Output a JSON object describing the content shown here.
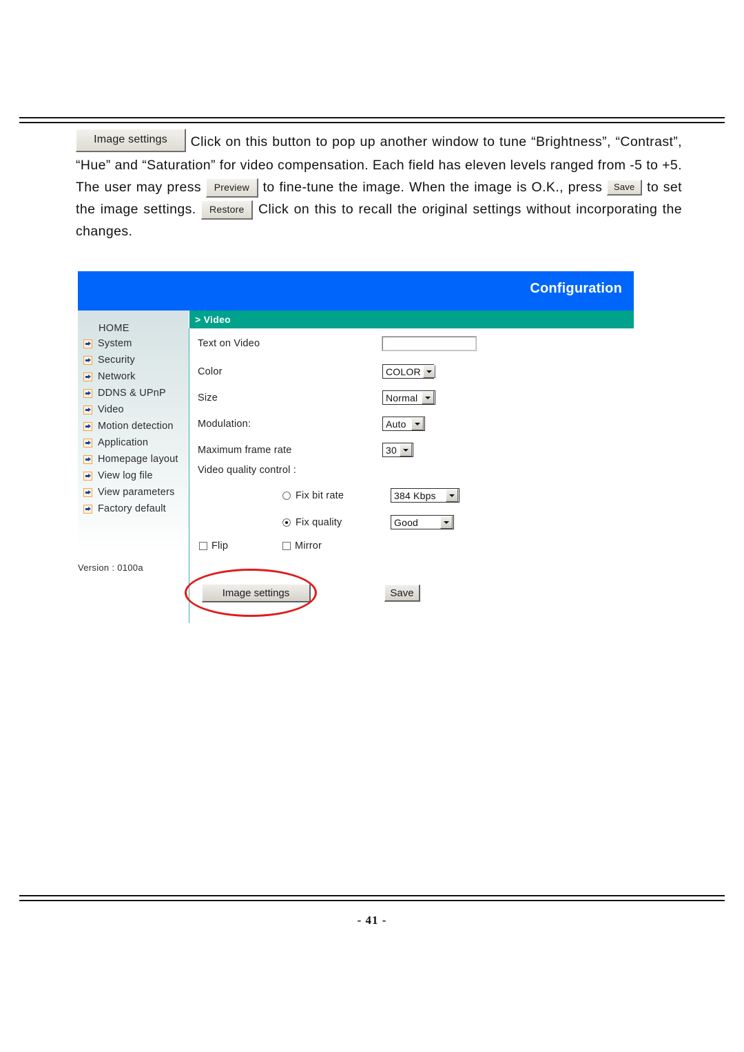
{
  "document": {
    "page_number": "- 41 -",
    "paragraph": {
      "btn_image_settings": "Image settings",
      "text_1": "Click on this button to pop up another window to tune “Brightness”, “Contrast”, “Hue” and “Saturation” for video compensation. Each field has eleven levels ranged from -5 to +5. The user may press",
      "btn_preview": "Preview",
      "text_2": "to fine-tune the image. When the image is O.K., press",
      "btn_save": "Save",
      "text_3": "to set the image settings.",
      "btn_restore": "Restore",
      "text_4": "Click on this to recall the original settings without incorporating the changes."
    }
  },
  "config_ui": {
    "header": {
      "title": "Configuration",
      "bg_color": "#0066fb"
    },
    "subbar": {
      "breadcrumb": "> Video",
      "bg_color": "#00a28c"
    },
    "sidebar": {
      "home_label": "HOME",
      "items": [
        {
          "label": "System",
          "icon": "arrow-icon"
        },
        {
          "label": "Security",
          "icon": "arrow-icon"
        },
        {
          "label": "Network",
          "icon": "arrow-icon"
        },
        {
          "label": "DDNS & UPnP",
          "icon": "arrow-icon"
        },
        {
          "label": "Video",
          "icon": "arrow-icon"
        },
        {
          "label": "Motion detection",
          "icon": "arrow-icon"
        },
        {
          "label": "Application",
          "icon": "arrow-icon"
        },
        {
          "label": "Homepage layout",
          "icon": "arrow-icon"
        },
        {
          "label": "View log file",
          "icon": "arrow-icon"
        },
        {
          "label": "View parameters",
          "icon": "arrow-icon"
        },
        {
          "label": "Factory default",
          "icon": "arrow-icon"
        }
      ],
      "version": "Version : 0100a"
    },
    "form": {
      "text_on_video": {
        "label": "Text on Video",
        "value": "",
        "placeholder": ""
      },
      "color": {
        "label": "Color",
        "value": "COLOR"
      },
      "size": {
        "label": "Size",
        "value": "Normal"
      },
      "modulation": {
        "label": "Modulation:",
        "value": "Auto"
      },
      "max_frame_rate": {
        "label": "Maximum frame rate",
        "value": "30"
      },
      "video_quality_control": {
        "label": "Video quality control :"
      },
      "fix_bit_rate": {
        "label": "Fix bit rate",
        "selected": false,
        "value": "384 Kbps"
      },
      "fix_quality": {
        "label": "Fix quality",
        "selected": true,
        "value": "Good"
      },
      "flip": {
        "label": "Flip",
        "checked": false
      },
      "mirror": {
        "label": "Mirror",
        "checked": false
      },
      "btn_image_settings": "Image settings",
      "btn_save": "Save"
    }
  }
}
